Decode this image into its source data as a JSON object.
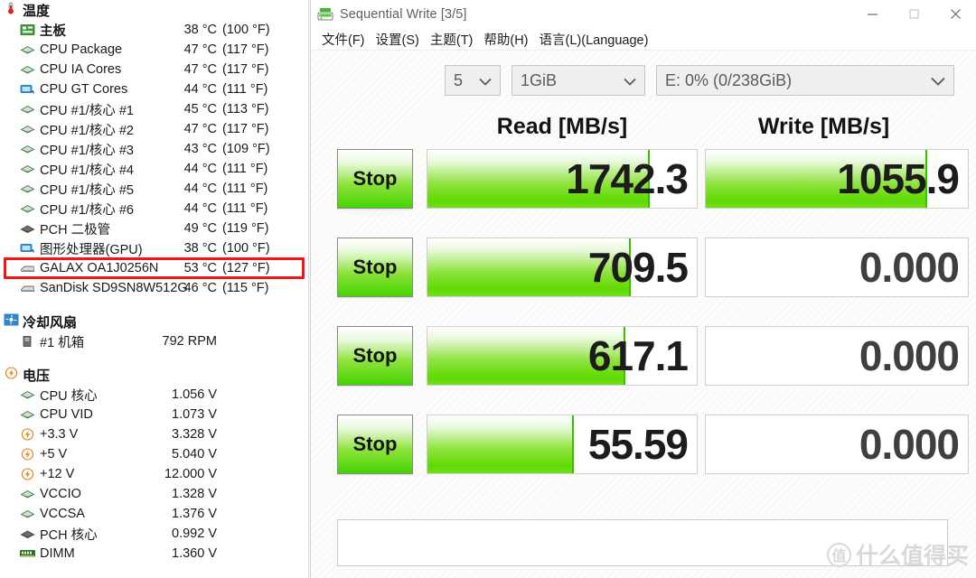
{
  "hwinfo": {
    "groups": [
      {
        "name": "temperatures",
        "label": "温度",
        "icon": "thermometer-icon",
        "rows": [
          {
            "icon": "motherboard-icon",
            "label": "主板",
            "value": "38 °C",
            "value2": "(100 °F)",
            "bold": true
          },
          {
            "icon": "cpu-chip-icon",
            "label": "CPU Package",
            "value": "47 °C",
            "value2": "(117 °F)"
          },
          {
            "icon": "cpu-chip-icon",
            "label": "CPU IA Cores",
            "value": "47 °C",
            "value2": "(117 °F)"
          },
          {
            "icon": "gpu-icon",
            "label": "CPU GT Cores",
            "value": "44 °C",
            "value2": "(111 °F)"
          },
          {
            "icon": "cpu-chip-icon",
            "label": "CPU #1/核心 #1",
            "value": "45 °C",
            "value2": "(113 °F)"
          },
          {
            "icon": "cpu-chip-icon",
            "label": "CPU #1/核心 #2",
            "value": "47 °C",
            "value2": "(117 °F)"
          },
          {
            "icon": "cpu-chip-icon",
            "label": "CPU #1/核心 #3",
            "value": "43 °C",
            "value2": "(109 °F)"
          },
          {
            "icon": "cpu-chip-icon",
            "label": "CPU #1/核心 #4",
            "value": "44 °C",
            "value2": "(111 °F)"
          },
          {
            "icon": "cpu-chip-icon",
            "label": "CPU #1/核心 #5",
            "value": "44 °C",
            "value2": "(111 °F)"
          },
          {
            "icon": "cpu-chip-icon",
            "label": "CPU #1/核心 #6",
            "value": "44 °C",
            "value2": "(111 °F)"
          },
          {
            "icon": "pch-chip-icon",
            "label": "PCH 二极管",
            "value": "49 °C",
            "value2": "(119 °F)"
          },
          {
            "icon": "gpu-icon",
            "label": "图形处理器(GPU)",
            "value": "38 °C",
            "value2": "(100 °F)"
          },
          {
            "icon": "drive-icon",
            "label": "GALAX OA1J0256N",
            "value": "53 °C",
            "value2": "(127 °F)",
            "highlighted": true
          },
          {
            "icon": "drive-icon",
            "label": "SanDisk SD9SN8W512G",
            "value": "46 °C",
            "value2": "(115 °F)"
          }
        ]
      },
      {
        "name": "fans",
        "label": "冷却风扇",
        "icon": "fan-icon",
        "rows": [
          {
            "icon": "case-icon",
            "label": "#1 机箱",
            "value": "792 RPM",
            "value2": ""
          }
        ]
      },
      {
        "name": "voltages",
        "label": "电压",
        "icon": "voltage-icon",
        "rows": [
          {
            "icon": "cpu-chip-icon",
            "label": "CPU 核心",
            "value": "1.056 V",
            "value2": ""
          },
          {
            "icon": "cpu-chip-icon",
            "label": "CPU VID",
            "value": "1.073 V",
            "value2": ""
          },
          {
            "icon": "voltage-icon",
            "label": "+3.3 V",
            "value": "3.328 V",
            "value2": ""
          },
          {
            "icon": "voltage-icon",
            "label": "+5 V",
            "value": "5.040 V",
            "value2": ""
          },
          {
            "icon": "voltage-icon",
            "label": "+12 V",
            "value": "12.000 V",
            "value2": ""
          },
          {
            "icon": "cpu-chip-icon",
            "label": "VCCIO",
            "value": "1.328 V",
            "value2": ""
          },
          {
            "icon": "cpu-chip-icon",
            "label": "VCCSA",
            "value": "1.376 V",
            "value2": ""
          },
          {
            "icon": "pch-chip-icon",
            "label": "PCH 核心",
            "value": "0.992 V",
            "value2": ""
          },
          {
            "icon": "dimm-icon",
            "label": "DIMM",
            "value": "1.360 V",
            "value2": ""
          }
        ]
      }
    ],
    "highlight_color": "#f51414"
  },
  "cdm": {
    "titlebar": {
      "icon": "crystaldiskmark-icon",
      "title": "Sequential Write [3/5]",
      "minimize_label": "—",
      "maximize_label": "▢",
      "close_label": "✕"
    },
    "menu": [
      {
        "name": "file",
        "label": "文件(F)"
      },
      {
        "name": "settings",
        "label": "设置(S)"
      },
      {
        "name": "theme",
        "label": "主题(T)"
      },
      {
        "name": "help",
        "label": "帮助(H)"
      },
      {
        "name": "language",
        "label": "语言(L)(Language)"
      }
    ],
    "toolbar": {
      "count_select": {
        "value": "5",
        "name": "test-count-select"
      },
      "size_select": {
        "value": "1GiB",
        "name": "test-size-select"
      },
      "drive_select": {
        "value": "E: 0% (0/238GiB)",
        "name": "target-drive-select"
      }
    },
    "columns": {
      "read": "Read [MB/s]",
      "write": "Write [MB/s]"
    },
    "stop_label": "Stop",
    "rows": [
      {
        "name": "seq1m-q8t1",
        "stop": "Stop",
        "read": "1742.3",
        "read_pct": 82,
        "write": "1055.9",
        "write_pct": 84,
        "write_idle": false
      },
      {
        "name": "seq1m-q1t1",
        "stop": "Stop",
        "read": "709.5",
        "read_pct": 75,
        "write": "0.000",
        "write_pct": 0,
        "write_idle": true
      },
      {
        "name": "rnd4k-q32t1",
        "stop": "Stop",
        "read": "617.1",
        "read_pct": 73,
        "write": "0.000",
        "write_pct": 0,
        "write_idle": true
      },
      {
        "name": "rnd4k-q1t1",
        "stop": "Stop",
        "read": "55.59",
        "read_pct": 54,
        "write": "0.000",
        "write_pct": 0,
        "write_idle": true
      }
    ],
    "status_text": "",
    "watermark": {
      "mark": "值",
      "text": "什么值得买"
    },
    "accent_green": "#5fd900",
    "button_green": "#45d400"
  }
}
